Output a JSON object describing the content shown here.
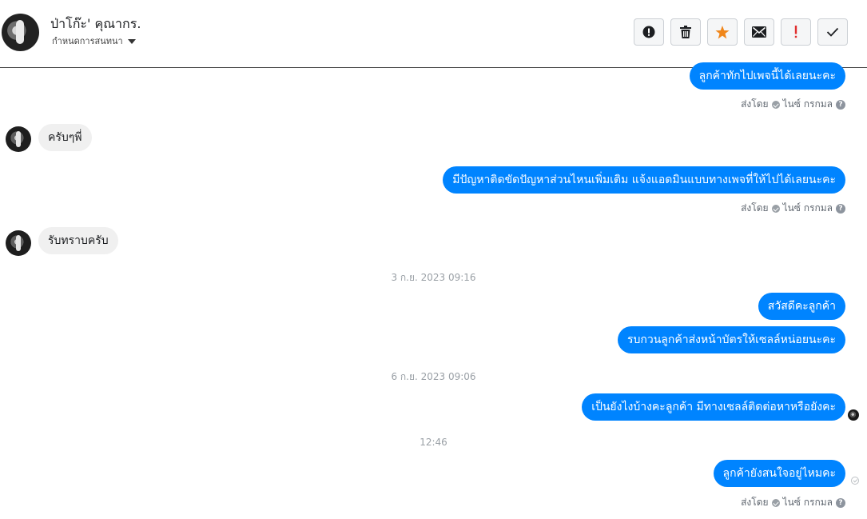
{
  "header": {
    "contact_name": "ป่าโก๊ะ' คุณากร.",
    "assign_label": "กำหนดการสนทนา",
    "toolbar": [
      {
        "name": "alert-button",
        "icon": "exclamation-circle-icon"
      },
      {
        "name": "delete-button",
        "icon": "trash-icon"
      },
      {
        "name": "star-button",
        "icon": "star-icon",
        "color": "#f0861a"
      },
      {
        "name": "mail-button",
        "icon": "envelope-icon"
      },
      {
        "name": "important-button",
        "icon": "exclamation-icon",
        "color": "#e02e2e"
      },
      {
        "name": "done-button",
        "icon": "check-icon"
      }
    ]
  },
  "messages": {
    "m1": "ลูกค้าทักไปเพจนี้ได้เลยนะคะ",
    "m1_sent_by": "ส่งโดย",
    "m1_sender": "ไนซ์ กรกมล",
    "m2": "ครับๆพี่",
    "m3": "มีปัญหาติดขัดปัญหาส่วนไหนเพิ่มเติม  แจ้งแอดมินแบบทางเพจที่ให้ไปได้เลยนะคะ",
    "m3_sent_by": "ส่งโดย",
    "m3_sender": "ไนซ์ กรกมล",
    "m4": "รับทราบครับ",
    "ts1": "3 ก.ย. 2023 09:16",
    "m5": "สวัสดีคะลูกค้า",
    "m6": "รบกวนลูกค้าส่งหน้าบัตรให้เซลล์หน่อยนะคะ",
    "ts2": "6 ก.ย. 2023 09:06",
    "m7": "เป็นยังไงบ้างคะลูกค้า มีทางเซลล์ติดต่อหาหรือยังคะ",
    "ts3": "12:46",
    "m8": "ลูกค้ายังสนใจอยู่ไหมคะ",
    "m8_sent_by": "ส่งโดย",
    "m8_sender": "ไนซ์ กรกมล"
  },
  "help_glyph": "?"
}
